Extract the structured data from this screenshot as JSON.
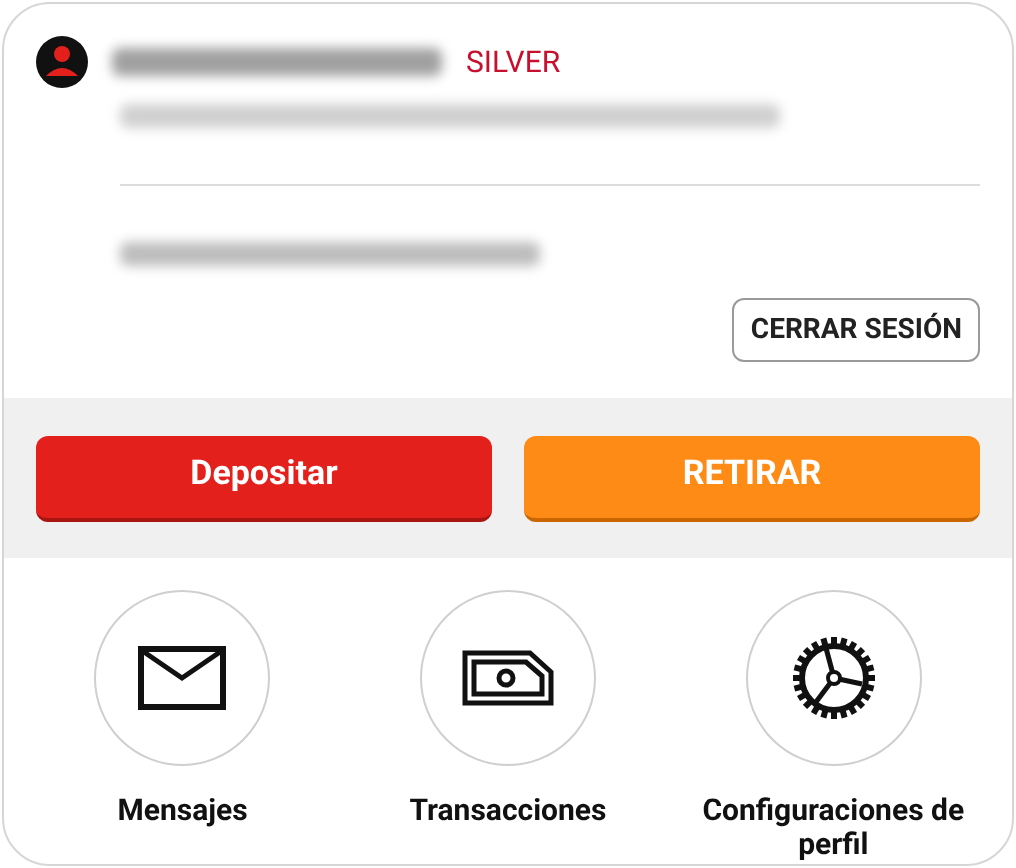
{
  "account": {
    "tier": "SILVER"
  },
  "logout_button": "CERRAR SESIÓN",
  "actions": [
    {
      "label": "Depositar",
      "kind": "deposit"
    },
    {
      "label": "RETIRAR",
      "kind": "withdraw"
    }
  ],
  "shortcuts": [
    {
      "label": "Mensajes",
      "kind": "messages"
    },
    {
      "label": "Transacciones",
      "kind": "transactions"
    },
    {
      "label": "Configuraciones de perfil",
      "kind": "settings"
    }
  ]
}
